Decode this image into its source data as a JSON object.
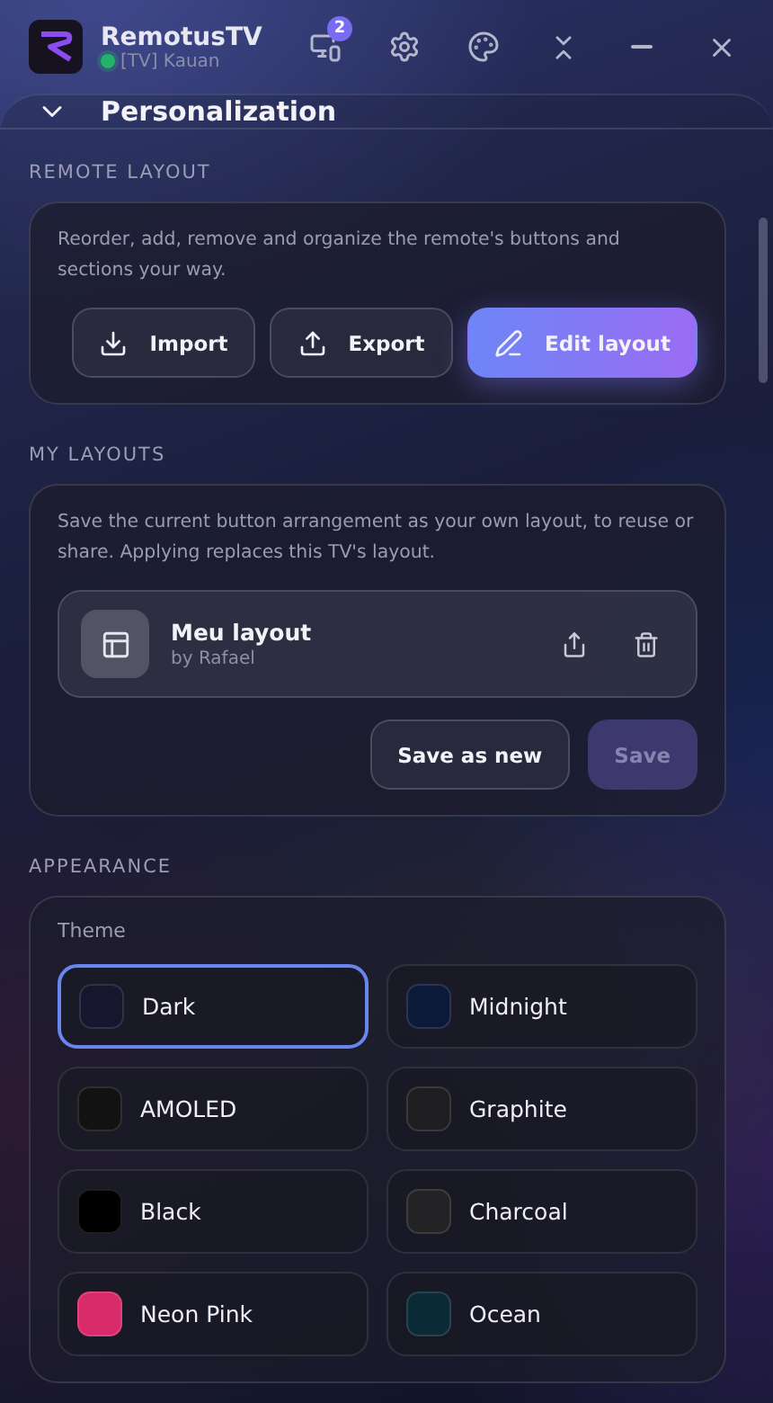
{
  "app": {
    "title": "RemotusTV",
    "device": "[TV] Kauan",
    "connected": true,
    "devices_badge": "2"
  },
  "panel": {
    "title": "Personalization",
    "expanded": true
  },
  "remote_layout": {
    "heading": "REMOTE LAYOUT",
    "description": "Reorder, add, remove and organize the remote's buttons and sections your way.",
    "buttons": [
      {
        "kind": "import",
        "label": "Import",
        "primary": false
      },
      {
        "kind": "export",
        "label": "Export",
        "primary": false
      },
      {
        "kind": "edit",
        "label": "Edit layout",
        "primary": true
      }
    ]
  },
  "my_layouts": {
    "heading": "MY LAYOUTS",
    "description": "Save the current button arrangement as your own layout, to reuse or share. Applying replaces this TV's layout.",
    "layouts": [
      {
        "name": "Meu layout",
        "author": "by Rafael"
      }
    ],
    "buttons": [
      {
        "label": "Save as new",
        "disabled": false
      },
      {
        "label": "Save",
        "disabled": true
      }
    ]
  },
  "appearance": {
    "heading": "APPEARANCE",
    "theme_label": "Theme",
    "themes": [
      {
        "name": "Dark",
        "color": "#16162e",
        "selected": true
      },
      {
        "name": "Midnight",
        "color": "#0c1a3a",
        "selected": false
      },
      {
        "name": "AMOLED",
        "color": "#121212",
        "selected": false
      },
      {
        "name": "Graphite",
        "color": "#1e1e20",
        "selected": false
      },
      {
        "name": "Black",
        "color": "#000000",
        "selected": false
      },
      {
        "name": "Charcoal",
        "color": "#232325",
        "selected": false
      },
      {
        "name": "Neon Pink",
        "color": "#d92a6a",
        "selected": false
      },
      {
        "name": "Ocean",
        "color": "#0a2a36",
        "selected": false
      }
    ]
  }
}
